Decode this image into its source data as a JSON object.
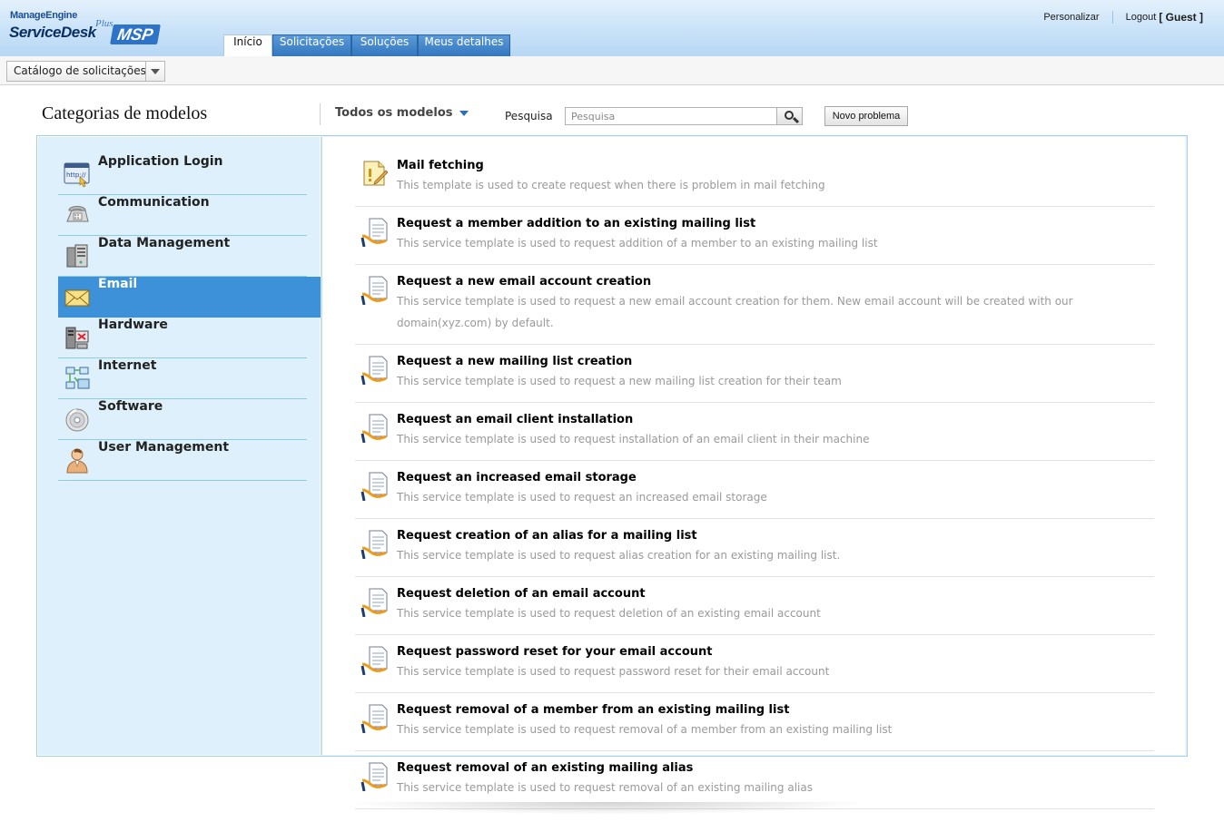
{
  "header": {
    "logo": {
      "manage_engine": "ManageEngine",
      "servicedesk": "ServiceDesk",
      "plus": "Plus",
      "msp": "MSP"
    },
    "links": {
      "personalize": "Personalizar",
      "logout": "Logout",
      "user": "[ Guest ]"
    },
    "tabs": [
      {
        "label": "Início",
        "active": true
      },
      {
        "label": "Solicitações",
        "active": false
      },
      {
        "label": "Soluções",
        "active": false
      },
      {
        "label": "Meus detalhes",
        "active": false
      }
    ]
  },
  "subbar": {
    "catalog_select": "Catálogo de solicitações"
  },
  "toolbar": {
    "title": "Categorias de modelos",
    "filter": "Todos os modelos",
    "search_label": "Pesquisa",
    "search_placeholder": "Pesquisa",
    "new_problem": "Novo problema"
  },
  "categories": [
    {
      "label": "Application Login",
      "icon": "browser-login-icon",
      "active": false
    },
    {
      "label": "Communication",
      "icon": "telephone-icon",
      "active": false
    },
    {
      "label": "Data Management",
      "icon": "server-tower-icon",
      "active": false
    },
    {
      "label": "Email",
      "icon": "envelope-icon",
      "active": true
    },
    {
      "label": "Hardware",
      "icon": "hardware-pc-icon",
      "active": false
    },
    {
      "label": "Internet",
      "icon": "network-icon",
      "active": false
    },
    {
      "label": "Software",
      "icon": "cd-disc-icon",
      "active": false
    },
    {
      "label": "User Management",
      "icon": "user-person-icon",
      "active": false
    }
  ],
  "templates": [
    {
      "title": "Mail fetching",
      "desc": "This template is used to create request when there is problem in mail fetching",
      "icon": "incident-note-icon"
    },
    {
      "title": "Request a member addition to an existing mailing list",
      "desc": "This service template is used to request addition of a member to an existing mailing list",
      "icon": "service-request-icon"
    },
    {
      "title": "Request a new email account creation",
      "desc": "This service template is used to request a new email account creation for them. New email account will be created with our domain(xyz.com) by default.",
      "icon": "service-request-icon"
    },
    {
      "title": "Request a new mailing list creation",
      "desc": "This service template is used to request a new mailing list creation for their team",
      "icon": "service-request-icon"
    },
    {
      "title": "Request an email client installation",
      "desc": "This service template is used to request installation of an email client in their machine",
      "icon": "service-request-icon"
    },
    {
      "title": "Request an increased email storage",
      "desc": "This service template is used to request an increased email storage",
      "icon": "service-request-icon"
    },
    {
      "title": "Request creation of an alias for a mailing list",
      "desc": "This service template is used to request alias creation for an existing mailing list.",
      "icon": "service-request-icon"
    },
    {
      "title": "Request deletion of an email account",
      "desc": "This service template is used to request deletion of an existing email account",
      "icon": "service-request-icon"
    },
    {
      "title": "Request password reset for your email account",
      "desc": "This service template is used to request password reset for their email account",
      "icon": "service-request-icon"
    },
    {
      "title": "Request removal of a member from an existing mailing list",
      "desc": "This service template is used to request removal of a member from an existing mailing list",
      "icon": "service-request-icon"
    },
    {
      "title": "Request removal of an existing mailing alias",
      "desc": "This service template is used to request removal of an existing mailing alias",
      "icon": "service-request-icon"
    }
  ]
}
